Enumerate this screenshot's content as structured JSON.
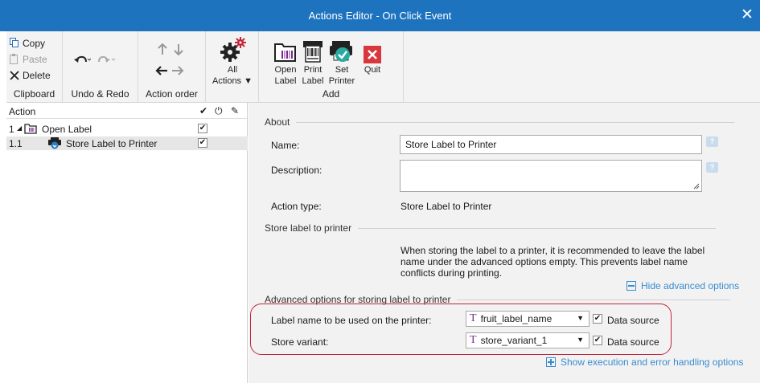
{
  "window": {
    "title": "Actions Editor - On Click Event"
  },
  "ribbon": {
    "clipboard": {
      "copy": "Copy",
      "paste": "Paste",
      "delete": "Delete",
      "group": "Clipboard"
    },
    "undo_redo": {
      "group": "Undo & Redo"
    },
    "action_order": {
      "group": "Action order"
    },
    "all_actions": {
      "line1": "All",
      "line2": "Actions ▼"
    },
    "add": {
      "open_label_1": "Open",
      "open_label_2": "Label",
      "print_label_1": "Print",
      "print_label_2": "Label",
      "set_printer_1": "Set",
      "set_printer_2": "Printer",
      "quit": "Quit",
      "group": "Add"
    }
  },
  "tree": {
    "header": {
      "action": "Action",
      "check": "✔",
      "power": "⏻",
      "edit": "✎"
    },
    "rows": [
      {
        "num": "1",
        "expander": "◢",
        "label": "Open Label",
        "checked": "✔"
      },
      {
        "num": "1.1",
        "label": "Store Label to Printer",
        "checked": "✔"
      }
    ]
  },
  "about": {
    "section": "About",
    "name_label": "Name:",
    "name_value": "Store Label to Printer",
    "description_label": "Description:",
    "description_value": "",
    "action_type_label": "Action type:",
    "action_type_value": "Store Label to Printer",
    "help": "?"
  },
  "store": {
    "section": "Store label to printer",
    "info": "When storing the label to a printer, it is recommended to leave the label name under the advanced options empty. This prevents label name conflicts during printing.",
    "hide_link": "Hide advanced options"
  },
  "advanced": {
    "section": "Advanced options for storing label to printer",
    "label_name_label": "Label name to be used on the printer:",
    "label_name_value": "fruit_label_name",
    "store_variant_label": "Store variant:",
    "store_variant_value": "store_variant_1",
    "data_source": "Data source",
    "checked": "✔",
    "var_icon": "T",
    "combo_arrow": "▼"
  },
  "execution_link": "Show execution and error handling options",
  "colors": {
    "titlebar": "#1e73be",
    "link": "#3a8ccf",
    "highlight": "#c0283a"
  }
}
